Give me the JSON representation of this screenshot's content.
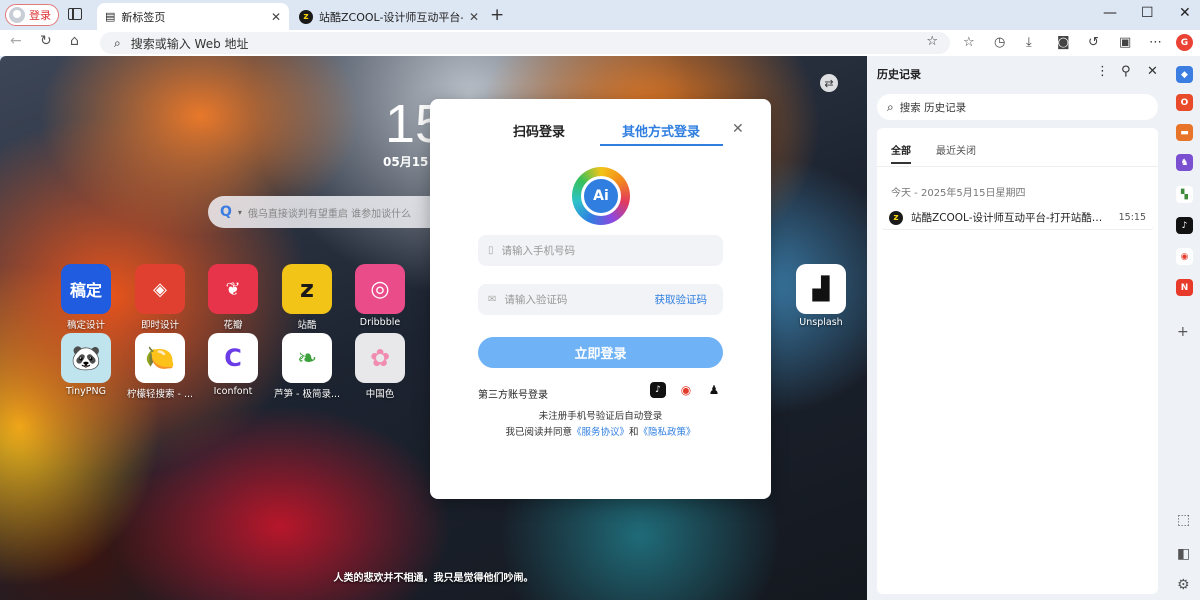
{
  "browser": {
    "profile_label": "登录",
    "tabs": [
      {
        "title": "新标签页",
        "active": true
      },
      {
        "title": "站酷ZCOOL-设计师互动平台-打",
        "active": false
      }
    ],
    "new_tab_label": "+",
    "window_controls": {
      "minimize": "—",
      "maximize": "☐",
      "close": "✕"
    }
  },
  "toolbar": {
    "address_placeholder": "搜索或输入 Web 地址"
  },
  "newtab": {
    "time": "15",
    "date": "05月15日",
    "search_placeholder": "俄乌直接谈判有望重启 谁参加谈什么",
    "apps": [
      {
        "label": "稿定设计",
        "icon_text": "稿定",
        "color": "#1f5ce0"
      },
      {
        "label": "即时设计",
        "icon_text": "◈",
        "color": "#e0402f"
      },
      {
        "label": "花瓣",
        "icon_text": "❦",
        "color": "#e8344a"
      },
      {
        "label": "站酷",
        "icon_text": "z",
        "color": "#f2c418"
      },
      {
        "label": "Dribbble",
        "icon_text": "◎",
        "color": "#ea4c89"
      },
      {
        "label": "Unsplash",
        "icon_text": "▟",
        "color": "#ffffff"
      },
      {
        "label": "TinyPNG",
        "icon_text": "🐼",
        "color": "#bfe4ee"
      },
      {
        "label": "柠檬轻搜索 - ...",
        "icon_text": "🍋",
        "color": "#ffffff"
      },
      {
        "label": "Iconfont",
        "icon_text": "C",
        "color": "#ffffff"
      },
      {
        "label": "芦笋 - 极简录...",
        "icon_text": "❧",
        "color": "#ffffff"
      },
      {
        "label": "中国色",
        "icon_text": "✿",
        "color": "#e8e8ea"
      }
    ],
    "quote": "人类的悲欢并不相通，我只是觉得他们吵闹。"
  },
  "login_modal": {
    "tab_qr": "扫码登录",
    "tab_other": "其他方式登录",
    "logo_text": "Ai",
    "phone_placeholder": "请输入手机号码",
    "code_placeholder": "请输入验证码",
    "get_code": "获取验证码",
    "submit": "立即登录",
    "third_party": "第三方账号登录",
    "note_1": "未注册手机号验证后自动登录",
    "note_2_prefix": "我已阅读并同意",
    "service_link": "《服务协议》",
    "and": "和",
    "privacy_link": "《隐私政策》"
  },
  "history": {
    "title": "历史记录",
    "search_placeholder": "搜索 历史记录",
    "tab_all": "全部",
    "tab_recent": "最近关闭",
    "date_group": "今天 - 2025年5月15日星期四",
    "items": [
      {
        "title": "站酷ZCOOL-设计师互动平台-打开站酷，发现更好的设计！",
        "time": "15:15"
      }
    ]
  }
}
